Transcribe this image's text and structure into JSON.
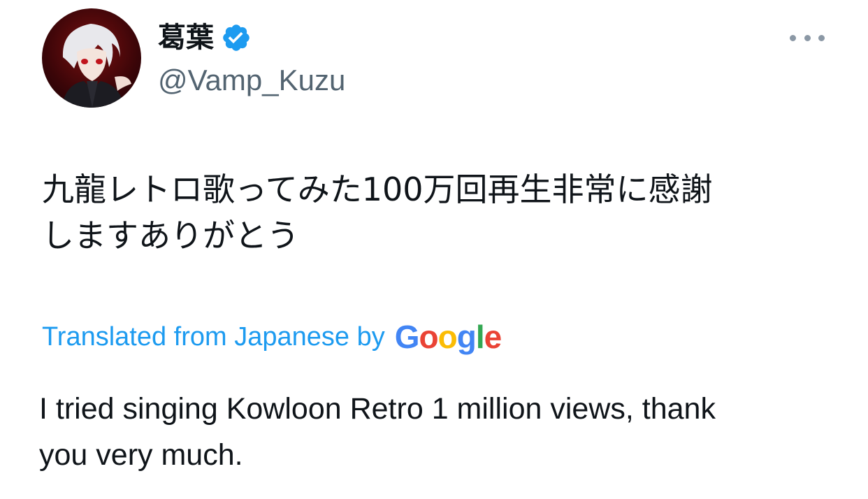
{
  "author": {
    "display_name": "葛葉",
    "handle": "@Vamp_Kuzu",
    "verified": true,
    "avatar_icon": "avatar-icon"
  },
  "more_menu_icon": "more-dots-icon",
  "tweet": {
    "text": "九龍レトロ歌ってみた100万回再生非常に感謝\nしますありがとう"
  },
  "translation": {
    "label": "Translated from Japanese by",
    "provider": [
      "G",
      "o",
      "o",
      "g",
      "l",
      "e"
    ],
    "provider_colors": [
      "#4285f4",
      "#ea4335",
      "#fbbc05",
      "#4285f4",
      "#34a853",
      "#ea4335"
    ],
    "text": "I tried singing Kowloon Retro 1 million views, thank\nyou very much."
  },
  "colors": {
    "accent": "#1d9bf0",
    "secondary_text": "#536471"
  }
}
